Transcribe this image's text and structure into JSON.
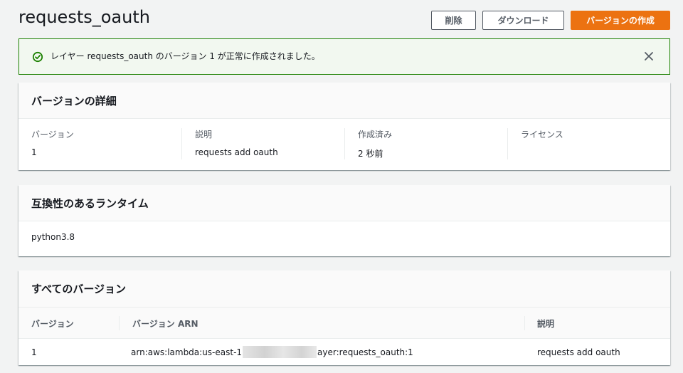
{
  "header": {
    "title": "requests_oauth",
    "delete_label": "削除",
    "download_label": "ダウンロード",
    "create_version_label": "バージョンの作成"
  },
  "flash": {
    "message": "レイヤー requests_oauth のバージョン 1 が正常に作成されました。",
    "icon": "check-circle-icon",
    "close_icon": "close-icon"
  },
  "details": {
    "title": "バージョンの詳細",
    "fields": [
      {
        "label": "バージョン",
        "value": "1"
      },
      {
        "label": "説明",
        "value": "requests add oauth"
      },
      {
        "label": "作成済み",
        "value": "2 秒前"
      },
      {
        "label": "ライセンス",
        "value": ""
      }
    ]
  },
  "runtimes": {
    "title": "互換性のあるランタイム",
    "value": "python3.8"
  },
  "versions": {
    "title": "すべてのバージョン",
    "columns": [
      "バージョン",
      "バージョン ARN",
      "説明"
    ],
    "rows": [
      {
        "version": "1",
        "arn_prefix": "arn:aws:lambda:us-east-1",
        "arn_suffix": "ayer:requests_oauth:1",
        "description": "requests add oauth"
      }
    ]
  },
  "colors": {
    "primary": "#ec7211",
    "success": "#1d8102",
    "success_bg": "#f2f8f0",
    "text": "#16191f",
    "muted": "#545b64"
  }
}
